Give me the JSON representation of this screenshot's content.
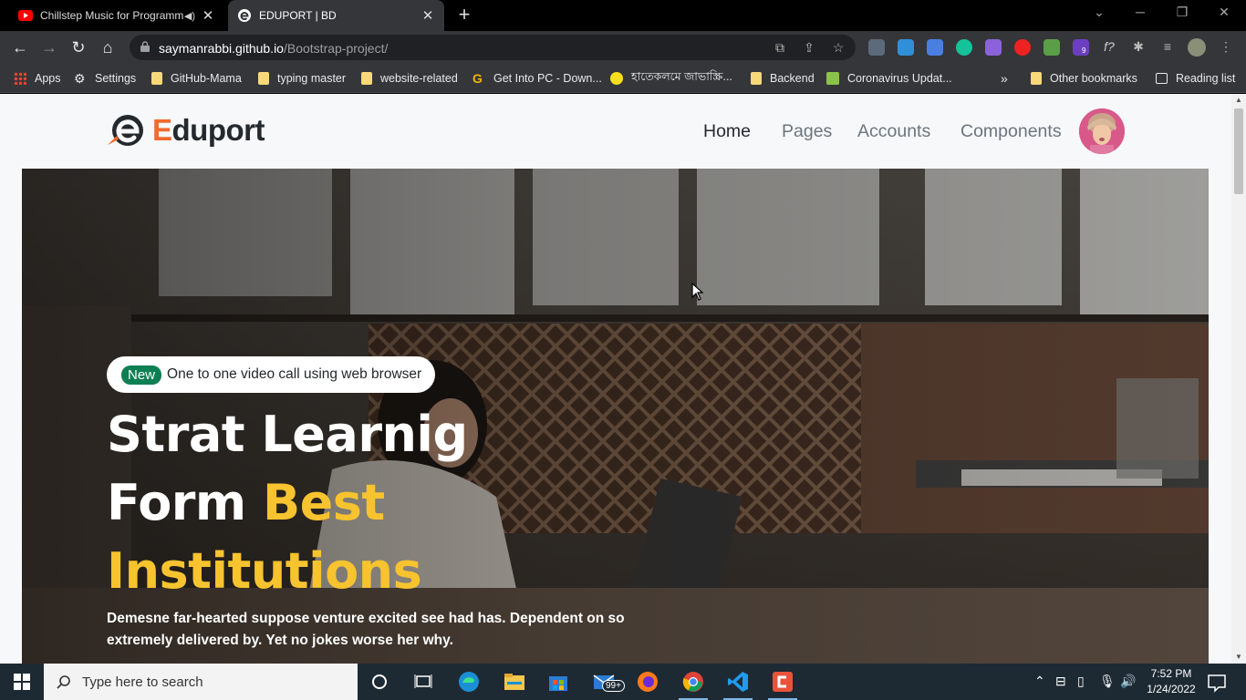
{
  "browser": {
    "tabs": [
      {
        "title": "Chillstep Music for Programmi",
        "active": false,
        "audio": true
      },
      {
        "title": "EDUPORT | BD",
        "active": true,
        "audio": false
      }
    ],
    "url_host": "saymanrabbi.github.io",
    "url_path": "/Bootstrap-project/",
    "bookmarks": [
      {
        "label": "Apps",
        "icon": "apps-grid-icon"
      },
      {
        "label": "Settings",
        "icon": "gear-icon"
      },
      {
        "label": "GitHub-Mama",
        "icon": "folder-icon"
      },
      {
        "label": "typing master",
        "icon": "folder-icon"
      },
      {
        "label": "website-related",
        "icon": "folder-icon"
      },
      {
        "label": "Get Into PC - Down...",
        "icon": "g-logo-icon"
      },
      {
        "label": "হাতেকলমে জাভাস্ক্রি...",
        "icon": "js-badge-icon"
      },
      {
        "label": "Backend",
        "icon": "folder-icon"
      },
      {
        "label": "Coronavirus Updat...",
        "icon": "w-badge-icon"
      }
    ],
    "bookmarks_overflow": "»",
    "other_bookmarks": "Other bookmarks",
    "reading_list": "Reading list",
    "extension_badge": "9"
  },
  "site": {
    "brand_first": "E",
    "brand_rest": "duport",
    "nav": [
      "Home",
      "Pages",
      "Accounts",
      "Components"
    ],
    "active_nav": "Home",
    "hero": {
      "badge_pill": "New",
      "badge_text": "One to one video call using web browser",
      "title_line1": "Strat Learnig",
      "title_line2_plain": "Form ",
      "title_line2_highlight": "Best",
      "title_line3_highlight": "Institutions",
      "description": "Demesne far-hearted suppose venture excited see had has. Dependent on so extremely delivered by. Yet no jokes worse her why."
    },
    "colors": {
      "accent_orange": "#f26a2e",
      "highlight_yellow": "#f7c32e",
      "badge_green": "#0d7f53"
    }
  },
  "taskbar": {
    "search_placeholder": "Type here to search",
    "mail_badge": "99+",
    "time": "7:52 PM",
    "date": "1/24/2022"
  }
}
